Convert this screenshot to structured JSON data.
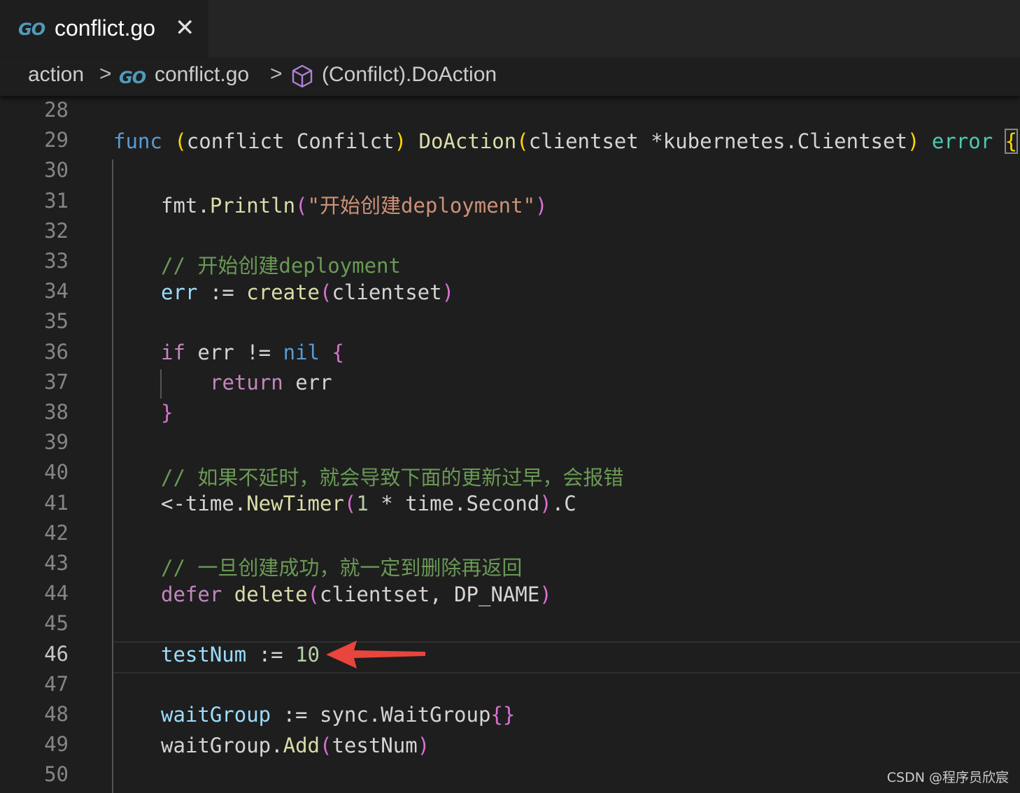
{
  "tab": {
    "icon": "go-file-icon",
    "logo_text": "GO",
    "title": "conflict.go",
    "close_glyph": "✕"
  },
  "breadcrumb": {
    "folder": "action",
    "separator": ">",
    "file": "conflict.go",
    "symbol": "(Confilct).DoAction",
    "symbol_icon": "method-cube-icon"
  },
  "editor": {
    "line_numbers": [
      "28",
      "29",
      "30",
      "31",
      "32",
      "33",
      "34",
      "35",
      "36",
      "37",
      "38",
      "39",
      "40",
      "41",
      "42",
      "43",
      "44",
      "45",
      "46",
      "47",
      "48",
      "49",
      "50"
    ],
    "active_line": "46",
    "lines": {
      "l29": {
        "func": "func",
        "p_open": "(",
        "recv": "conflict Confilct",
        "p_close": ")",
        "name": "DoAction",
        "a_open": "(",
        "params": "clientset *kubernetes.Clientset",
        "a_close": ")",
        "ret": "error",
        "brace": "{"
      },
      "l31": {
        "obj": "fmt.",
        "fn": "Println",
        "open": "(",
        "str": "\"开始创建deployment\"",
        "close": ")"
      },
      "l33": {
        "comment": "// 开始创建deployment"
      },
      "l34": {
        "var": "err",
        "op": " := ",
        "fn": "create",
        "open": "(",
        "arg": "clientset",
        "close": ")"
      },
      "l36": {
        "kw": "if",
        "mid": " err != ",
        "nil": "nil",
        "brace": "{"
      },
      "l37": {
        "kw": "return",
        "rest": " err"
      },
      "l38": {
        "brace": "}"
      },
      "l40": {
        "comment": "// 如果不延时，就会导致下面的更新过早，会报错"
      },
      "l41": {
        "pre": "<-time.",
        "fn": "NewTimer",
        "open": "(",
        "num": "1",
        "mid": " * time.Second",
        "close": ")",
        "post": ".C"
      },
      "l43": {
        "comment": "// 一旦创建成功，就一定到删除再返回"
      },
      "l44": {
        "kw": "defer",
        "fn": "delete",
        "open": "(",
        "args": "clientset, DP_NAME",
        "close": ")"
      },
      "l46": {
        "var": "testNum",
        "op": " := ",
        "num": "10"
      },
      "l48": {
        "var": "waitGroup",
        "op": " := ",
        "type": "sync.WaitGroup",
        "braces": "{}"
      },
      "l49": {
        "obj": "waitGroup.",
        "fn": "Add",
        "open": "(",
        "arg": "testNum",
        "close": ")"
      }
    }
  },
  "annotation": {
    "arrow_color": "#e8453c"
  },
  "watermark": "CSDN @程序员欣宸"
}
